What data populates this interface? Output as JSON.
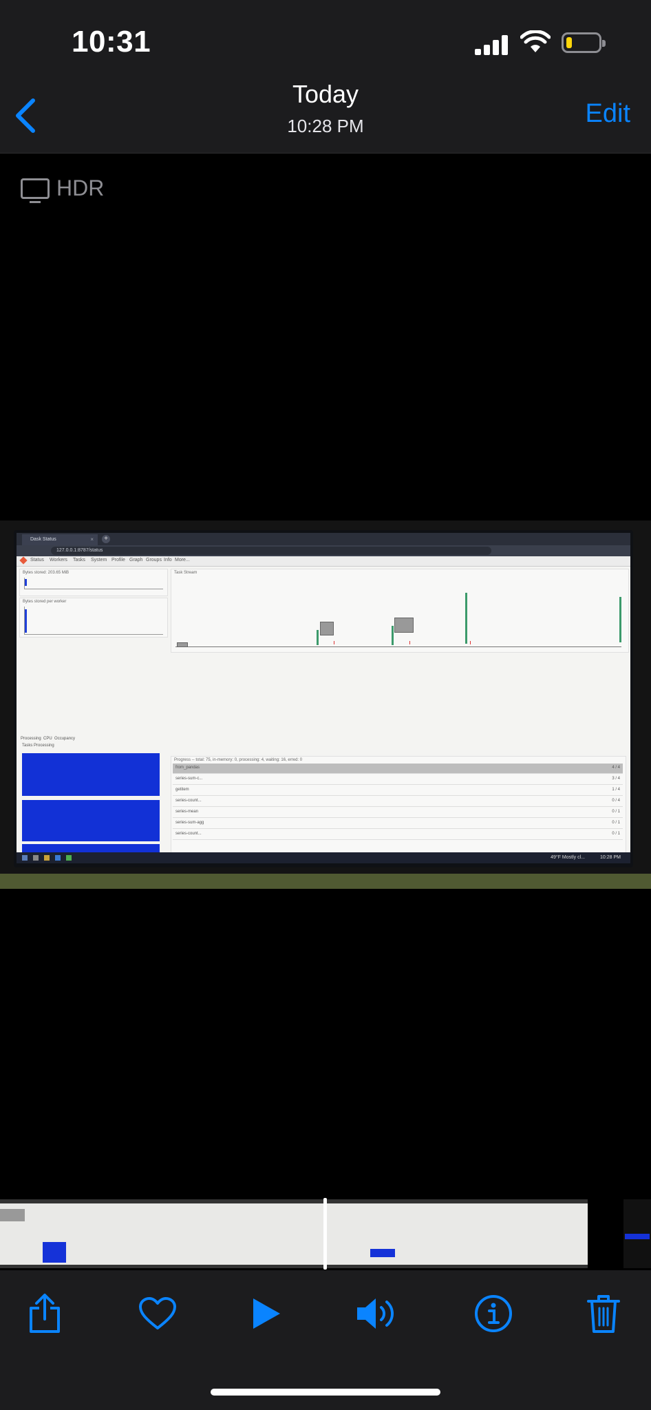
{
  "status": {
    "time": "10:31"
  },
  "nav": {
    "back_label": "",
    "title": "Today",
    "subtitle": "10:28 PM",
    "edit_label": "Edit"
  },
  "badge": {
    "label": "HDR"
  },
  "photo": {
    "browser": {
      "tab_title": "Dask Status",
      "url": "127.0.0.1:8787/status",
      "menu": [
        "Status",
        "Workers",
        "Tasks",
        "System",
        "Profile",
        "Graph",
        "Groups",
        "Info",
        "More..."
      ]
    },
    "panels": {
      "bytes_stored": "Bytes stored: 203.65 MiB",
      "bytes_per_worker": "Bytes stored per worker",
      "task_stream": "Task Stream",
      "tabs": [
        "Processing",
        "CPU",
        "Occupancy"
      ],
      "tasks_processing": "Tasks Processing",
      "progress_header": "Progress -- total: 75, in-memory: 0, processing: 4, waiting: 16, erred: 0"
    },
    "progress_rows": [
      {
        "label": "from_pandas",
        "count": "4 / 4"
      },
      {
        "label": "series-sum-c...",
        "count": "3 / 4"
      },
      {
        "label": "getitem",
        "count": "1 / 4"
      },
      {
        "label": "series-count...",
        "count": "0 / 4"
      },
      {
        "label": "series-mean",
        "count": "0 / 1"
      },
      {
        "label": "series-sum-agg",
        "count": "0 / 1"
      },
      {
        "label": "series-count...",
        "count": "0 / 1"
      }
    ],
    "taskbar": {
      "weather": "49°F Mostly cl...",
      "clock": "10:28 PM"
    }
  },
  "toolbar": {
    "share": "share-icon",
    "favorite": "heart-icon",
    "play": "play-icon",
    "sound": "speaker-icon",
    "info": "info-icon",
    "delete": "trash-icon"
  },
  "colors": {
    "accent": "#0a84ff",
    "bar_blue": "#1231d6",
    "battery_low": "#ffd60a"
  }
}
